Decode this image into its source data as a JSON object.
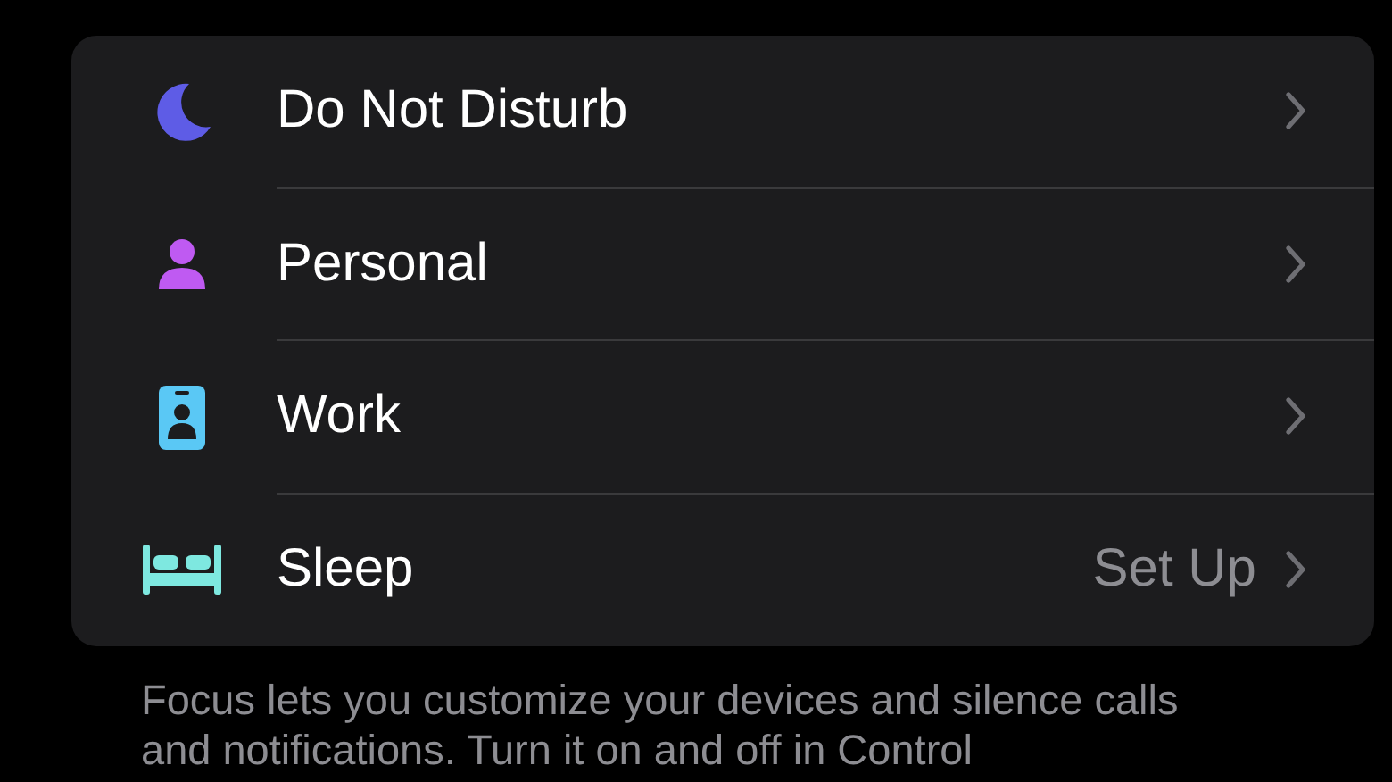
{
  "focus_modes": [
    {
      "label": "Do Not Disturb",
      "color": "#5e5ce6"
    },
    {
      "label": "Personal",
      "color": "#bf5af2"
    },
    {
      "label": "Work",
      "color": "#5ac8f5"
    },
    {
      "label": "Sleep",
      "color": "#7ee8e0",
      "detail": "Set Up"
    }
  ],
  "footer": "Focus lets you customize your devices and silence calls and notifications. Turn it on and off in Control"
}
